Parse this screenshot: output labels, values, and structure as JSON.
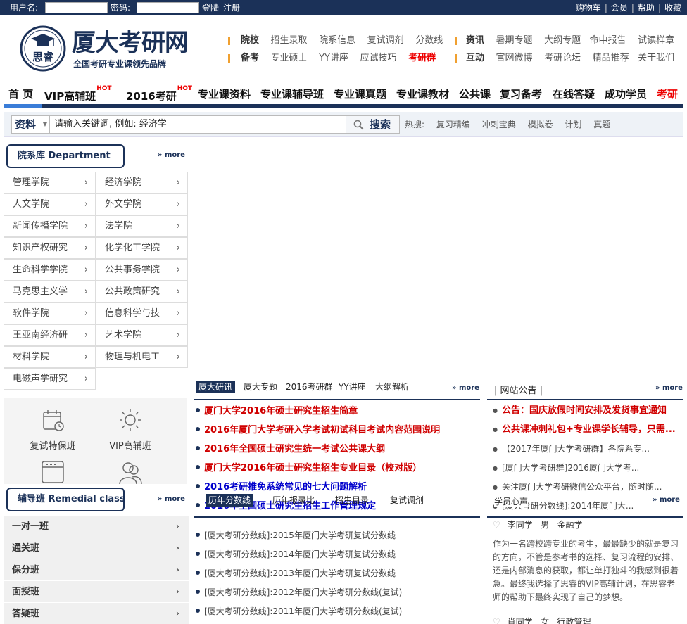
{
  "topbar": {
    "username_label": "用户名:",
    "password_label": "密码:",
    "login": "登陆",
    "register": "注册",
    "links": [
      "购物车",
      "会员",
      "帮助",
      "收藏"
    ]
  },
  "logo": {
    "seal_text": "思睿",
    "title": "厦大考研网",
    "slogan": "全国考研专业课领先品牌"
  },
  "header_nav": {
    "row1_left": [
      "院校",
      "招生录取",
      "院系信息",
      "复试调剂",
      "分数线"
    ],
    "row2_left": [
      "备考",
      "专业硕士",
      "YY讲座",
      "应试技巧",
      "考研群"
    ],
    "row1_right": [
      "资讯",
      "暑期专题",
      "大纲专题",
      "命中报告",
      "试读样章"
    ],
    "row2_right": [
      "互动",
      "官网微博",
      "考研论坛",
      "精品推荐",
      "关于我们"
    ]
  },
  "main_nav": {
    "items": [
      "首 页",
      "VIP高辅班",
      "2016考研",
      "专业课资料",
      "专业课辅导班",
      "专业课真题",
      "专业课教材",
      "公共课",
      "复习备考",
      "在线答疑",
      "成功学员",
      "考研"
    ],
    "hot": "HOT"
  },
  "search": {
    "category": "资料",
    "placeholder": "请输入关键词, 例如:  经济学",
    "button": "搜索",
    "hot_label": "热搜:",
    "hot_terms": [
      "复习精编",
      "冲刺宝典",
      "模拟卷",
      "计划",
      "真题"
    ]
  },
  "departments": {
    "title": "院系库  Department",
    "more": "» more",
    "left": [
      "管理学院",
      "人文学院",
      "新闻传播学院",
      "知识产权研究",
      "生命科学学院",
      "马克思主义学",
      "软件学院",
      "王亚南经济研",
      "材料学院",
      "电磁声学研究"
    ],
    "right": [
      "经济学院",
      "外文学院",
      "法学院",
      "化学化工学院",
      "公共事务学院",
      "公共政策研究",
      "信息科学与技",
      "艺术学院",
      "物理与机电工"
    ]
  },
  "quick": {
    "items": [
      "复试特保班",
      "VIP高辅班"
    ]
  },
  "remedial": {
    "title": "辅导班  Remedial class",
    "more": "» more",
    "items": [
      "一对一班",
      "通关班",
      "保分班",
      "面授班",
      "答疑班"
    ]
  },
  "news": {
    "tabs": [
      "厦大研讯",
      "厦大专题",
      "2016考研群",
      "YY讲座",
      "大纲解析"
    ],
    "more": "» more",
    "items": [
      {
        "text": "厦门大学2016年硕士研究生招生简章",
        "color": "red"
      },
      {
        "text": "2016年厦门大学考研入学考试初试科目考试内容范围说明",
        "color": "red"
      },
      {
        "text": "2016年全国硕士研究生统一考试公共课大纲",
        "color": "red"
      },
      {
        "text": "厦门大学2016年硕士研究生招生专业目录（校对版）",
        "color": "red"
      },
      {
        "text": "2016考研推免系统常见的七大问题解析",
        "color": "blue"
      },
      {
        "text": "2016年全国硕士研究生招生工作管理规定",
        "color": "blue"
      }
    ]
  },
  "scores": {
    "tabs": [
      "历年分数线",
      "历年报录比",
      "招生目录",
      "复试调剂"
    ],
    "more": "» more",
    "items": [
      "[厦大考研分数线]:2015年厦门大学考研复试分数线",
      "[厦大考研分数线]:2014年厦门大学考研复试分数线",
      "[厦大考研分数线]:2013年厦门大学考研复试分数线",
      "[厦大考研分数线]:2012年厦门大学考研分数线(复试)",
      "[厦大考研分数线]:2011年厦门大学考研分数线(复试)"
    ]
  },
  "notice": {
    "title": "| 网站公告 |",
    "more": "» more",
    "items": [
      {
        "text": "公告：国庆放假时间安排及发货事宜通知",
        "color": "red"
      },
      {
        "text": "公共课冲刺礼包+专业课学长辅导，只需...",
        "color": "red"
      },
      {
        "text": "【2017年厦门大学考研群】各院系专...",
        "color": "normal"
      },
      {
        "text": "[厦门大学考研群]2016厦门大学考...",
        "color": "normal"
      },
      {
        "text": "关注厦门大学考研微信公众平台，随时随...",
        "color": "normal"
      },
      {
        "text": "[厦大考研分数线]:2014年厦门大...",
        "color": "normal"
      }
    ]
  },
  "voice": {
    "title": "学员心声",
    "more": "» more",
    "student1": {
      "name": "李同学",
      "gender": "男",
      "major": "金融学"
    },
    "text": "作为一名跨校跨专业的考生，最最缺少的就是复习的方向，不管是参考书的选择、复习流程的安排、还是内部消息的获取，都让单打独斗的我感到很着急。最终我选择了思睿的VIP高辅计划，在思睿老师的帮助下最终实现了自己的梦想。",
    "student2": {
      "name": "肖同学",
      "gender": "女",
      "major": "行政管理"
    }
  }
}
